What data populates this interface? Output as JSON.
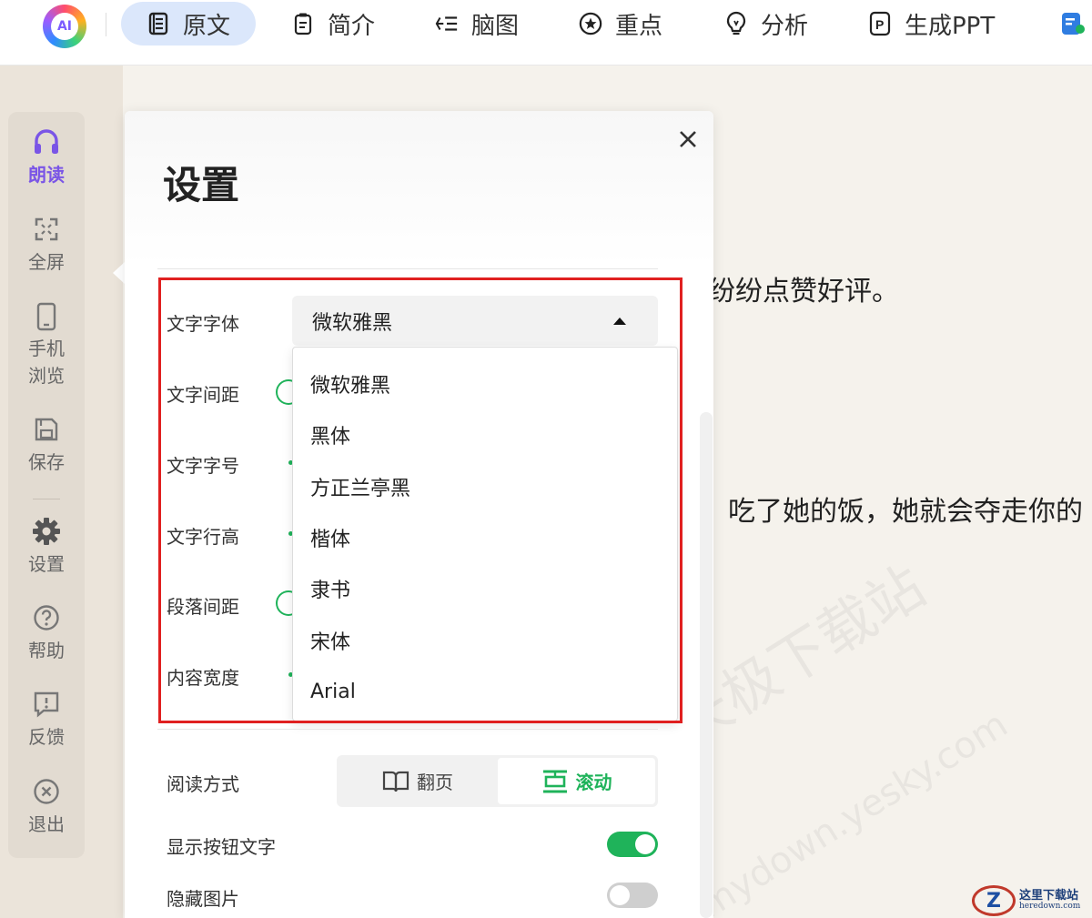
{
  "toolbar": {
    "logo_text": "AI",
    "tabs": [
      {
        "label": "原文",
        "icon": "document-icon"
      },
      {
        "label": "简介",
        "icon": "notes-icon"
      },
      {
        "label": "脑图",
        "icon": "mindmap-icon"
      },
      {
        "label": "重点",
        "icon": "star-icon"
      },
      {
        "label": "分析",
        "icon": "bulb-icon"
      },
      {
        "label": "生成PPT",
        "icon": "ppt-icon"
      }
    ]
  },
  "rail": {
    "items": [
      {
        "label": "朗读",
        "icon": "headphones-icon"
      },
      {
        "label": "全屏",
        "icon": "fullscreen-icon"
      },
      {
        "label": "手机浏览",
        "icon": "phone-icon"
      },
      {
        "label": "保存",
        "icon": "save-icon"
      },
      {
        "label": "设置",
        "icon": "gear-icon"
      },
      {
        "label": "帮助",
        "icon": "help-icon"
      },
      {
        "label": "反馈",
        "icon": "feedback-icon"
      },
      {
        "label": "退出",
        "icon": "exit-icon"
      }
    ]
  },
  "reader": {
    "line1": "纷纷点赞好评。",
    "line2": "吃了她的饭，她就会夺走你的"
  },
  "settings": {
    "title": "设置",
    "rows": {
      "font": "文字字体",
      "spacing": "文字间距",
      "size": "文字字号",
      "line_height": "文字行高",
      "paragraph": "段落间距",
      "width": "内容宽度"
    },
    "font_selected": "微软雅黑",
    "font_options": [
      "微软雅黑",
      "黑体",
      "方正兰亭黑",
      "楷体",
      "隶书",
      "宋体",
      "Arial"
    ],
    "reading_mode_label": "阅读方式",
    "mode_flip": "翻页",
    "mode_scroll": "滚动",
    "show_button_text": "显示按钮文字",
    "hide_images": "隐藏图片"
  },
  "watermark": {
    "main": "天极下载站",
    "sub": "mydown.yesky.com"
  },
  "corner_logo": {
    "name": "这里下载站",
    "url": "heredown.com"
  },
  "colors": {
    "accent_green": "#1fb35a",
    "accent_purple": "#7a55e6",
    "highlight_red": "#e02020"
  }
}
